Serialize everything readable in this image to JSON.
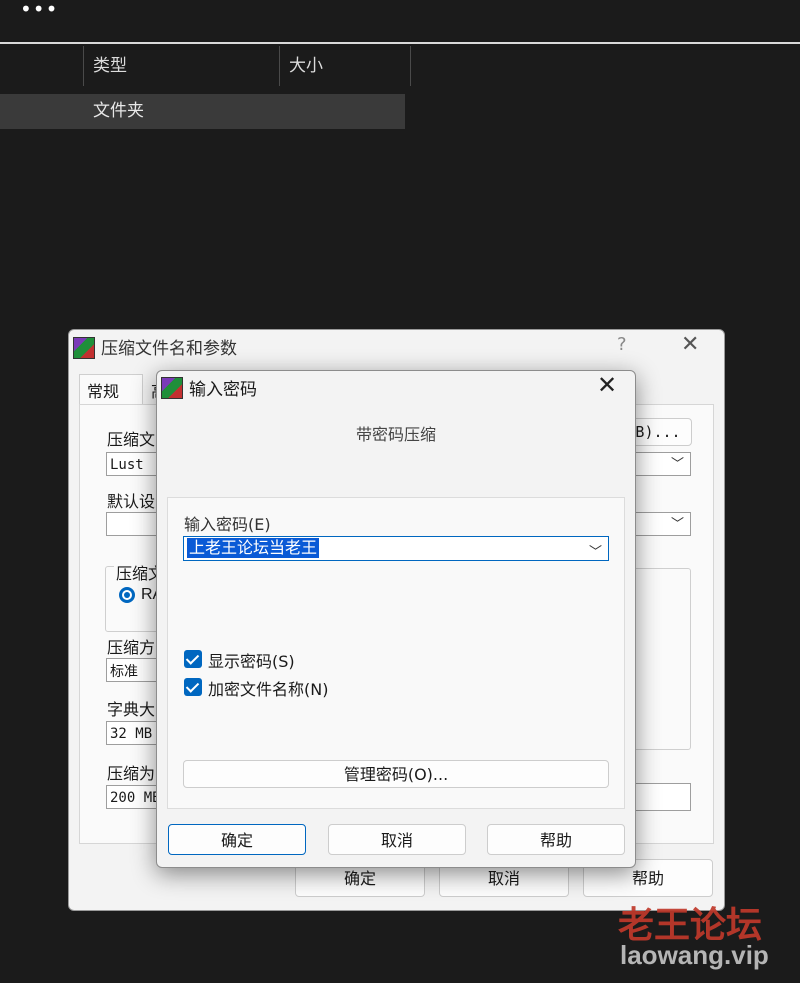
{
  "explorer": {
    "more_label": "•••",
    "columns": [
      "类型",
      "大小"
    ],
    "selected_row_type": "文件夹"
  },
  "back_dialog": {
    "title": "压缩文件名和参数",
    "help_label": "?",
    "close_label": "✕",
    "tabs": [
      "常规",
      "高"
    ],
    "archive_name_label": "压缩文",
    "archive_name_value": "Lust",
    "browse_label": "B)...",
    "default_profile_label": "默认设",
    "format_group_label": "压缩文",
    "format_option": "RA",
    "method_label": "压缩方",
    "method_value": "标准",
    "dict_label": "字典大",
    "dict_value": "32 MB",
    "split_label": "压缩为",
    "split_value": "200 MB",
    "buttons": [
      "确定",
      "取消",
      "帮助"
    ]
  },
  "front_dialog": {
    "title": "输入密码",
    "close_label": "✕",
    "subtitle": "带密码压缩",
    "password_label": "输入密码(E)",
    "password_value": "上老王论坛当老王",
    "show_password_label": "显示密码(S)",
    "encrypt_names_label": "加密文件名称(N)",
    "show_password_checked": true,
    "encrypt_names_checked": true,
    "manage_label": "管理密码(O)...",
    "buttons": [
      "确定",
      "取消",
      "帮助"
    ]
  },
  "watermark": {
    "line1": "老王论坛",
    "line2": "laowang.vip"
  },
  "colors": {
    "accent": "#0067c0",
    "background": "#1b1b1b",
    "watermark": "#c0392b"
  }
}
